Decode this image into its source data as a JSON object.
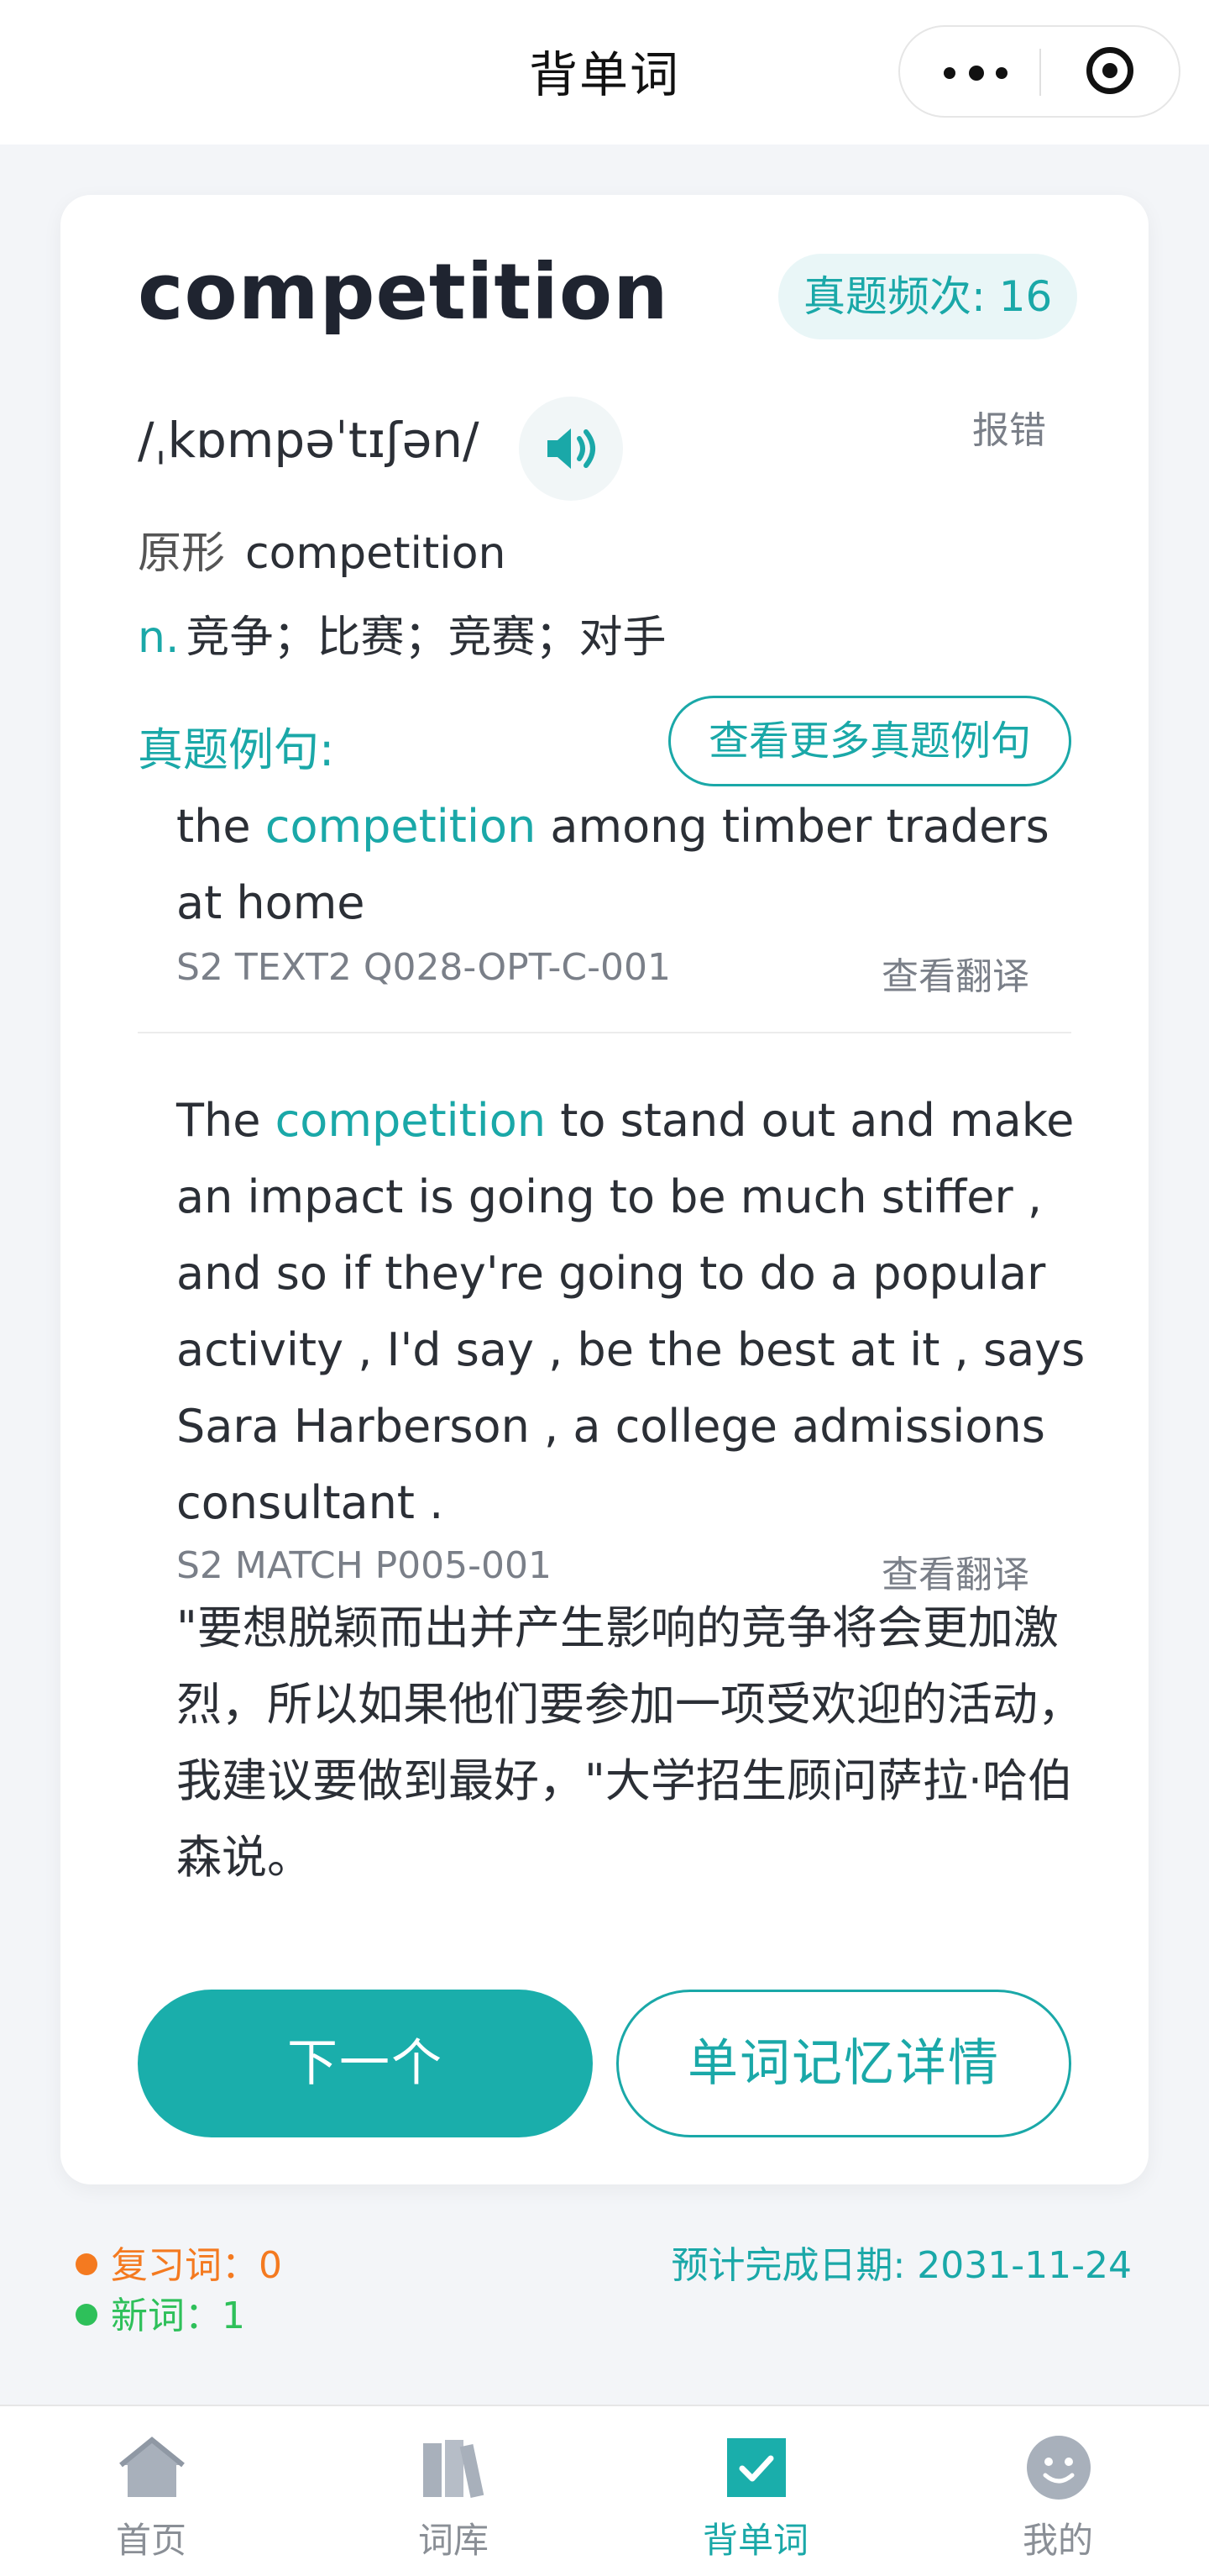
{
  "header": {
    "title": "背单词"
  },
  "word": {
    "text": "competition",
    "frequency": "真题频次: 16",
    "phonetic": "/ˌkɒmpəˈtɪʃən/",
    "report": "报错",
    "original_label": "原形",
    "original_value": "competition",
    "pos": "n.",
    "definition": "竞争；比赛；竞赛；对手"
  },
  "examples": {
    "label": "真题例句:",
    "more_button": "查看更多真题例句",
    "items": [
      {
        "pre": "the ",
        "keyword": "competition",
        "post": " among timber traders at home",
        "source": "S2 TEXT2 Q028-OPT-C-001",
        "translate_label": "查看翻译"
      },
      {
        "pre": "The ",
        "keyword": "competition",
        "post": " to stand out and make an impact is going to be much stiffer , and so if they're going to do a popular activity , I'd say , be the best at it , says Sara Harberson , a college admissions consultant .",
        "source": "S2 MATCH P005-001",
        "translate_label": "查看翻译",
        "translation": "\"要想脱颖而出并产生影响的竞争将会更加激烈，所以如果他们要参加一项受欢迎的活动，我建议要做到最好，\"大学招生顾问萨拉·哈伯森说。"
      }
    ]
  },
  "actions": {
    "next": "下一个",
    "detail": "单词记忆详情"
  },
  "stats": {
    "review": "复习词：0",
    "new": "新词：1",
    "eta": "预计完成日期: 2031-11-24"
  },
  "tabs": [
    {
      "label": "首页",
      "icon": "home-icon"
    },
    {
      "label": "词库",
      "icon": "books-icon"
    },
    {
      "label": "背单词",
      "icon": "check-icon",
      "active": true
    },
    {
      "label": "我的",
      "icon": "face-icon"
    }
  ],
  "colors": {
    "accent": "#1aa8a8",
    "review": "#f47a20",
    "new": "#2ec05a"
  }
}
